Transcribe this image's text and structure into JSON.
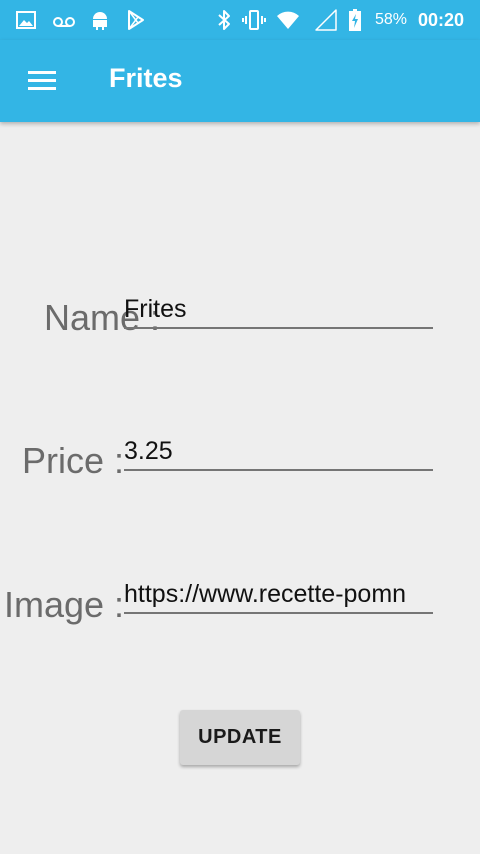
{
  "status_bar": {
    "battery": "58%",
    "time": "00:20",
    "icons": [
      "gallery-icon",
      "voicemail-icon",
      "android-icon",
      "play-store-icon",
      "bluetooth-icon",
      "vibrate-icon",
      "wifi-icon",
      "signal-icon",
      "battery-charging-icon"
    ]
  },
  "app_bar": {
    "title": "Frites",
    "menu_icon": "hamburger-menu-icon"
  },
  "form": {
    "name_label": "Name :",
    "name_value": "Frites",
    "price_label": "Price :",
    "price_value": "3.25",
    "image_label": "Image :",
    "image_value": "https://www.recette-pomn"
  },
  "actions": {
    "update_label": "UPDATE"
  },
  "colors": {
    "accent": "#33b5e5",
    "background": "#eeeeee",
    "button": "#d6d6d6"
  }
}
